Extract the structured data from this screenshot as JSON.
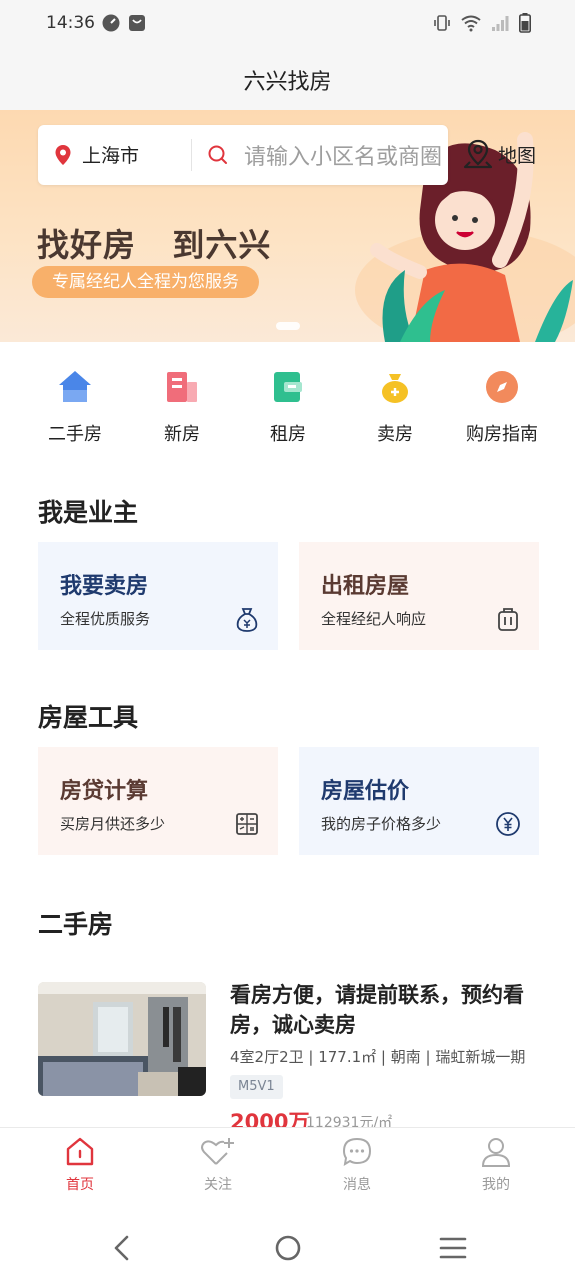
{
  "status_bar": {
    "time": "14:36"
  },
  "header": {
    "title": "六兴找房"
  },
  "banner": {
    "city": "上海市",
    "search_placeholder": "请输入小区名或商圈",
    "map_label": "地图",
    "slogan": "找好房   到六兴",
    "slogan_sub": "专属经纪人全程为您服务"
  },
  "categories": [
    {
      "label": "二手房",
      "icon": "house-icon",
      "color": "#4a86e8"
    },
    {
      "label": "新房",
      "icon": "building-icon",
      "color": "#f06d7a"
    },
    {
      "label": "租房",
      "icon": "wallet-icon",
      "color": "#2fbf8f"
    },
    {
      "label": "卖房",
      "icon": "money-bag-icon",
      "color": "#f5c125"
    },
    {
      "label": "购房指南",
      "icon": "compass-icon",
      "color": "#f28a5c"
    }
  ],
  "owner_section": {
    "title": "我是业主",
    "cards": [
      {
        "title": "我要卖房",
        "sub": "全程优质服务",
        "icon": "money-bag-icon"
      },
      {
        "title": "出租房屋",
        "sub": "全程经纪人响应",
        "icon": "luggage-icon"
      }
    ]
  },
  "tools_section": {
    "title": "房屋工具",
    "cards": [
      {
        "title": "房贷计算",
        "sub": "买房月供还多少",
        "icon": "calculator-icon"
      },
      {
        "title": "房屋估价",
        "sub": "我的房子价格多少",
        "icon": "yuan-icon"
      }
    ]
  },
  "secondhand_section": {
    "title": "二手房",
    "listing": {
      "title": "看房方便，请提前联系，预约看房，诚心卖房",
      "meta": "4室2厅2卫 | 177.1㎡ | 朝南 | 瑞虹新城一期",
      "tag": "M5V1",
      "price": "2000万",
      "unit_price": "112931元/㎡"
    }
  },
  "bottom_nav": [
    {
      "label": "首页",
      "icon": "home-icon",
      "active": true
    },
    {
      "label": "关注",
      "icon": "heart-plus-icon",
      "active": false
    },
    {
      "label": "消息",
      "icon": "chat-icon",
      "active": false
    },
    {
      "label": "我的",
      "icon": "user-icon",
      "active": false
    }
  ],
  "colors": {
    "accent": "#e0353d",
    "sell_title": "#1f3a6e",
    "rent_title": "#5a3a32",
    "blue_card_bg": "#f2f6fd",
    "pink_card_bg": "#fdf4f1"
  }
}
